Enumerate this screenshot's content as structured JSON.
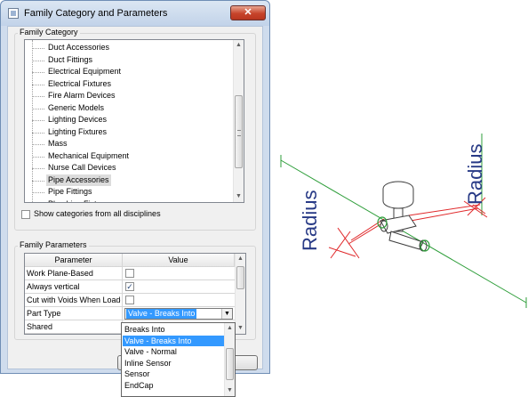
{
  "window": {
    "title": "Family Category and Parameters",
    "close_icon": "close-x-icon"
  },
  "family_category": {
    "label": "Family Category",
    "items": [
      "Duct Accessories",
      "Duct Fittings",
      "Electrical Equipment",
      "Electrical Fixtures",
      "Fire Alarm Devices",
      "Generic Models",
      "Lighting Devices",
      "Lighting Fixtures",
      "Mass",
      "Mechanical Equipment",
      "Nurse Call Devices",
      "Pipe Accessories",
      "Pipe Fittings",
      "Plumbing Fixtures"
    ],
    "selected": "Pipe Accessories",
    "show_all_label": "Show categories from all disciplines",
    "show_all_checked": false
  },
  "family_parameters": {
    "label": "Family Parameters",
    "columns": [
      "Parameter",
      "Value"
    ],
    "rows": [
      {
        "name": "Work Plane-Based",
        "type": "checkbox",
        "checked": false
      },
      {
        "name": "Always vertical",
        "type": "checkbox",
        "checked": true
      },
      {
        "name": "Cut with Voids When Loaded",
        "type": "checkbox",
        "checked": false
      },
      {
        "name": "Part Type",
        "type": "combo",
        "value": "Valve - Breaks Into"
      },
      {
        "name": "Shared",
        "type": "text",
        "value": ""
      }
    ]
  },
  "part_type_dropdown": {
    "options": [
      "Breaks Into",
      "Valve - Breaks Into",
      "Valve - Normal",
      "Inline Sensor",
      "Sensor",
      "EndCap"
    ],
    "selected": "Valve - Breaks Into"
  },
  "drawing": {
    "label_left": "Radius",
    "label_right": "Radius",
    "colors": {
      "reference_line": "#2e9e3a",
      "dimension": "#e0292b",
      "label": "#283a86",
      "geometry": "#3c3c3c"
    }
  }
}
